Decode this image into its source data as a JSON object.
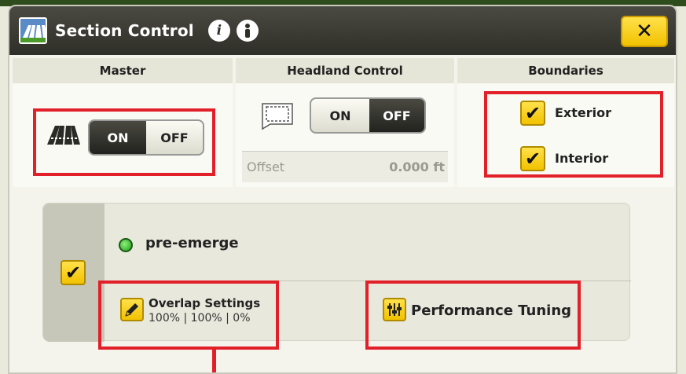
{
  "window": {
    "title": "Section Control",
    "close_label": "✕"
  },
  "sections": {
    "master": {
      "heading": "Master",
      "on_label": "ON",
      "off_label": "OFF",
      "state": "ON"
    },
    "headland": {
      "heading": "Headland Control",
      "on_label": "ON",
      "off_label": "OFF",
      "state": "OFF",
      "offset_label": "Offset",
      "offset_value": "0.000 ft"
    },
    "boundaries": {
      "heading": "Boundaries",
      "exterior_label": "Exterior",
      "interior_label": "Interior",
      "exterior_checked": true,
      "interior_checked": true
    }
  },
  "product": {
    "name": "pre-emerge",
    "enabled": true,
    "overlap": {
      "title": "Overlap Settings",
      "values": "100% | 100% | 0%"
    },
    "performance_label": "Performance Tuning"
  },
  "icons": {
    "app": "section-control-icon",
    "info1": "info-icon",
    "info2": "info-person-icon",
    "master": "implement-sections-icon",
    "headland": "headland-boundary-icon",
    "overlap": "pencil-icon",
    "performance": "sliders-icon"
  },
  "colors": {
    "accent": "#f2c200",
    "highlight": "#e2202a",
    "led": "#1e9a1a",
    "titlebar": "#2f2f29"
  }
}
